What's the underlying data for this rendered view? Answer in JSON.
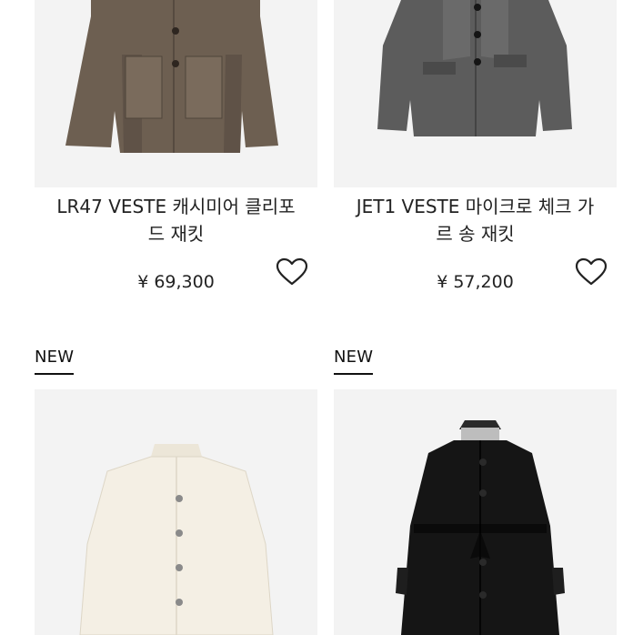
{
  "products": [
    {
      "title_line1": "LR47 VESTE 캐시미어 클리포",
      "title_line2": "드 재킷",
      "price": "¥ 69,300",
      "colors": {
        "fabric": "#6d5f51",
        "fabric_dark": "#4f443a",
        "button": "#2e2620"
      }
    },
    {
      "title_line1": "JET1 VESTE 마이크로 체크 가",
      "title_line2": "르 송 재킷",
      "price": "¥ 57,200",
      "colors": {
        "fabric": "#5c5c5c",
        "fabric_dark": "#3c3c3c",
        "button": "#151515"
      }
    },
    {
      "badge": "NEW",
      "colors": {
        "fabric": "#f2ede2",
        "fabric_dark": "#ddd6c6",
        "button": "#8a8a8a"
      }
    },
    {
      "badge": "NEW",
      "colors": {
        "fabric": "#151515",
        "fabric_dark": "#000000",
        "button": "#2a2a2a"
      }
    }
  ]
}
